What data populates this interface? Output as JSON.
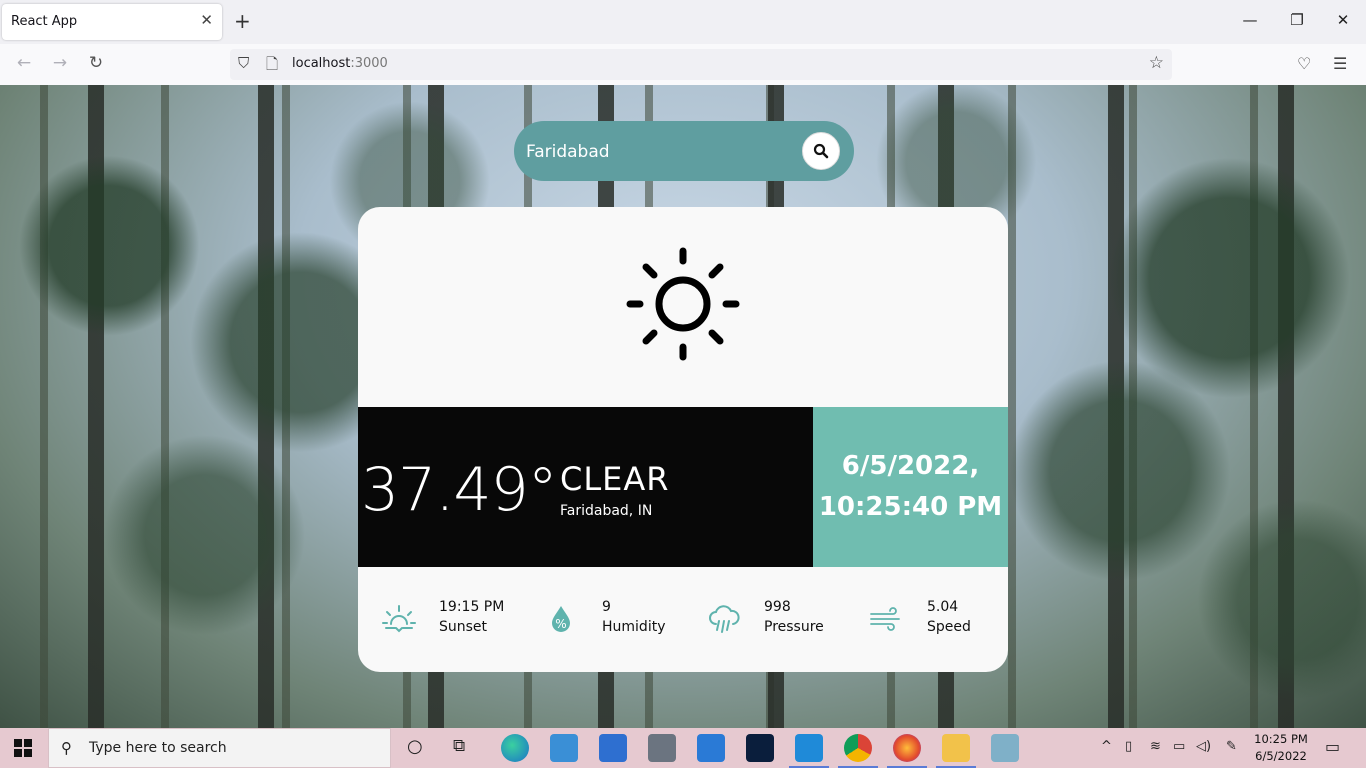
{
  "browser": {
    "tab_title": "React App",
    "url_host": "localhost",
    "url_port": ":3000"
  },
  "search": {
    "value": "Faridabad"
  },
  "weather": {
    "icon": "sun-icon",
    "temperature": "37.49°",
    "condition": "CLEAR",
    "location": "Faridabad, IN",
    "date_line1": "6/5/2022,",
    "date_line2": "10:25:40 PM"
  },
  "stats": [
    {
      "icon": "sunset-icon",
      "value": "19:15 PM",
      "label": "Sunset"
    },
    {
      "icon": "humidity-icon",
      "value": "9",
      "label": "Humidity"
    },
    {
      "icon": "rain-cloud-icon",
      "value": "998",
      "label": "Pressure"
    },
    {
      "icon": "wind-icon",
      "value": "5.04",
      "label": "Speed"
    }
  ],
  "taskbar": {
    "search_placeholder": "Type here to search",
    "time": "10:25 PM",
    "date": "6/5/2022"
  },
  "colors": {
    "search_bg": "#5f9ea0",
    "date_band": "#70bdb0",
    "accent_icon": "#5fb3ad"
  }
}
